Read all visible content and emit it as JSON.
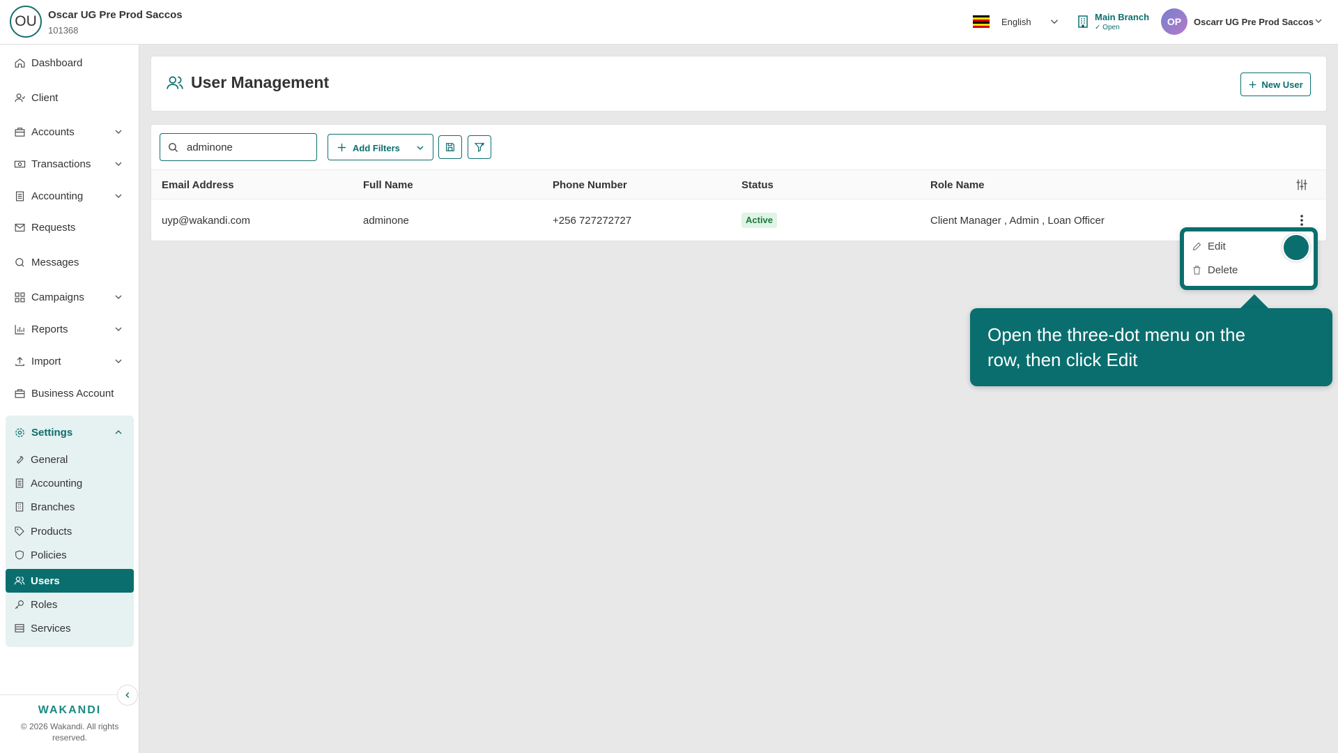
{
  "header": {
    "org_initials": "OU",
    "org_name": "Oscar UG Pre Prod Saccos",
    "org_id": "101368",
    "language": "English",
    "branch_name": "Main Branch",
    "branch_status": "Open",
    "user_initials": "OP",
    "user_name": "Oscarr UG Pre Prod Saccos",
    "accent_color": "#0b6e6e"
  },
  "sidebar": {
    "items": [
      {
        "label": "Dashboard",
        "icon": "home-icon"
      },
      {
        "label": "Client",
        "icon": "client-icon"
      },
      {
        "label": "Accounts",
        "icon": "accounts-icon",
        "expandable": true
      },
      {
        "label": "Transactions",
        "icon": "transactions-icon",
        "expandable": true
      },
      {
        "label": "Accounting",
        "icon": "accounting-icon",
        "expandable": true
      },
      {
        "label": "Requests",
        "icon": "mail-icon"
      },
      {
        "label": "Messages",
        "icon": "messages-icon"
      },
      {
        "label": "Campaigns",
        "icon": "campaigns-icon",
        "expandable": true
      },
      {
        "label": "Reports",
        "icon": "reports-icon",
        "expandable": true
      },
      {
        "label": "Import",
        "icon": "upload-icon",
        "expandable": true
      },
      {
        "label": "Business Account",
        "icon": "briefcase-icon"
      }
    ],
    "settings": {
      "label": "Settings",
      "sub_items": [
        {
          "label": "General",
          "icon": "wrench-icon"
        },
        {
          "label": "Accounting",
          "icon": "ledger-icon"
        },
        {
          "label": "Branches",
          "icon": "building-icon"
        },
        {
          "label": "Products",
          "icon": "tag-icon"
        },
        {
          "label": "Policies",
          "icon": "shield-icon"
        },
        {
          "label": "Users",
          "icon": "users-icon",
          "active": true
        },
        {
          "label": "Roles",
          "icon": "key-icon"
        },
        {
          "label": "Services",
          "icon": "list-icon"
        }
      ]
    },
    "brand": "WAKANDI",
    "copyright": "© 2026 Wakandi. All rights reserved."
  },
  "page": {
    "title": "User Management",
    "new_user_label": "New User"
  },
  "toolbar": {
    "search_value": "adminone",
    "add_filters_label": "Add Filters"
  },
  "table": {
    "columns": [
      "Email Address",
      "Full Name",
      "Phone Number",
      "Status",
      "Role Name"
    ],
    "rows": [
      {
        "email": "uyp@wakandi.com",
        "full_name": "adminone",
        "phone": "+256 727272727",
        "status": "Active",
        "roles": "Client Manager , Admin , Loan Officer"
      }
    ]
  },
  "row_menu": {
    "edit_label": "Edit",
    "delete_label": "Delete"
  },
  "callout": {
    "text": "Open the three-dot menu on the row, then click Edit"
  }
}
